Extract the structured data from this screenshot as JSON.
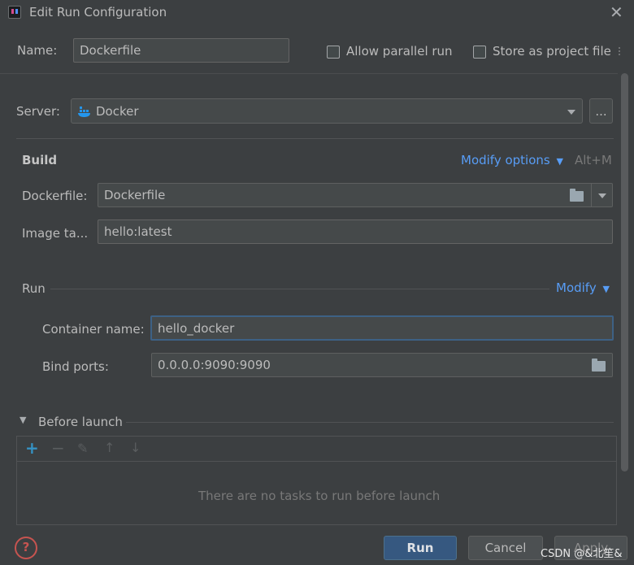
{
  "window": {
    "title": "Edit Run Configuration"
  },
  "header": {
    "name_label": "Name:",
    "name_value": "Dockerfile",
    "allow_parallel_label": "Allow parallel run",
    "store_as_project_label": "Store as project file"
  },
  "server": {
    "label": "Server:",
    "value": "Docker",
    "more_label": "..."
  },
  "build": {
    "title": "Build",
    "modify_options_label": "Modify options",
    "shortcut": "Alt+M",
    "dockerfile_label": "Dockerfile:",
    "dockerfile_value": "Dockerfile",
    "image_tag_label": "Image ta...",
    "image_tag_value": "hello:latest"
  },
  "run": {
    "title": "Run",
    "modify_label": "Modify",
    "container_name_label": "Container name:",
    "container_name_value": "hello_docker",
    "bind_ports_label": "Bind ports:",
    "bind_ports_value": "0.0.0.0:9090:9090"
  },
  "before_launch": {
    "title": "Before launch",
    "empty_text": "There are no tasks to run before launch"
  },
  "footer": {
    "run_label": "Run",
    "cancel_label": "Cancel",
    "apply_label": "Apply",
    "watermark": "CSDN @&北笙&"
  },
  "colors": {
    "background": "#3c3f41",
    "accent_link": "#589df6",
    "primary_button": "#365880",
    "focus_border": "#3d6185",
    "add_icon": "#3592c4",
    "help_icon": "#c75450"
  }
}
